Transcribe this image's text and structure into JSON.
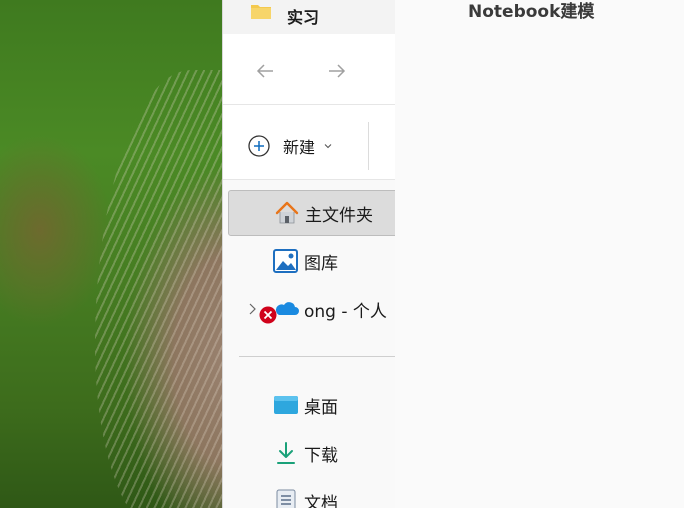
{
  "explorer": {
    "tab_title": "实习",
    "new_label": "新建",
    "nav_items": [
      {
        "label": "主文件夹",
        "icon": "home-icon",
        "selected": true
      },
      {
        "label": "图库",
        "icon": "gallery-icon"
      },
      {
        "label": "ong - 个人",
        "icon": "onedrive-icon",
        "status": "error",
        "expandable": true
      },
      {
        "label": "桌面",
        "icon": "desktop-icon"
      },
      {
        "label": "下载",
        "icon": "download-icon"
      },
      {
        "label": "文档",
        "icon": "documents-icon"
      }
    ]
  },
  "right_pane": {
    "title": "Notebook建模"
  },
  "colors": {
    "accent": "#0f6cbd",
    "selected_bg": "#dcdcdc",
    "error_badge": "#d0021b"
  }
}
